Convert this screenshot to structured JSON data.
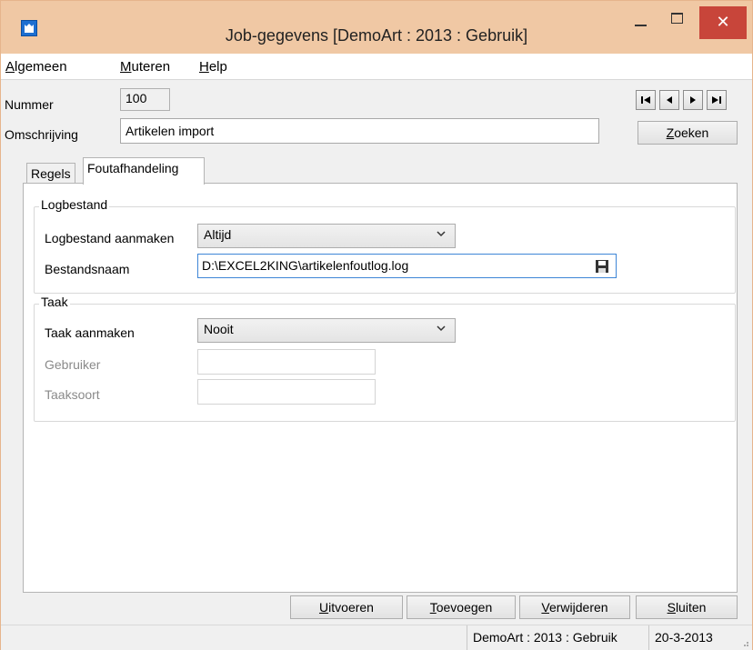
{
  "window": {
    "title": "Job-gegevens  [DemoArt : 2013 : Gebruik]",
    "close_glyph": "✕"
  },
  "menu": {
    "items": [
      {
        "label": "Algemeen",
        "accel": ""
      },
      {
        "label": "Muteren",
        "accel": "M"
      },
      {
        "label": "Help",
        "accel": "H"
      }
    ]
  },
  "header": {
    "nummer_label": "Nummer",
    "nummer_value": "100",
    "omschrijving_label": "Omschrijving",
    "omschrijving_value": "Artikelen import",
    "nav": {
      "first": "⏮",
      "prev": "◀",
      "next": "▶",
      "last": "⏭"
    },
    "zoeken_label": "Zoeken"
  },
  "tabs": [
    {
      "label": "Regels",
      "active": false
    },
    {
      "label": "Foutafhandeling",
      "active": true
    }
  ],
  "logbestand": {
    "legend": "Logbestand",
    "aanmaken_label": "Logbestand aanmaken",
    "aanmaken_value": "Altijd",
    "bestandsnaam_label": "Bestandsnaam",
    "bestandsnaam_value": "D:\\EXCEL2KING\\artikelenfoutlog.log"
  },
  "taak": {
    "legend": "Taak",
    "aanmaken_label": "Taak aanmaken",
    "aanmaken_value": "Nooit",
    "gebruiker_label": "Gebruiker",
    "gebruiker_value": "",
    "taaksoort_label": "Taaksoort",
    "taaksoort_value": ""
  },
  "buttons": {
    "uitvoeren": "Uitvoeren",
    "toevoegen": "Toevoegen",
    "verwijderen": "Verwijderen",
    "sluiten": "Sluiten"
  },
  "status": {
    "context": "DemoArt : 2013 : Gebruik",
    "date": "20-3-2013"
  },
  "colors": {
    "titlebar": "#f0c8a4",
    "close_button": "#c8453a",
    "focus_border": "#3e86d6"
  }
}
